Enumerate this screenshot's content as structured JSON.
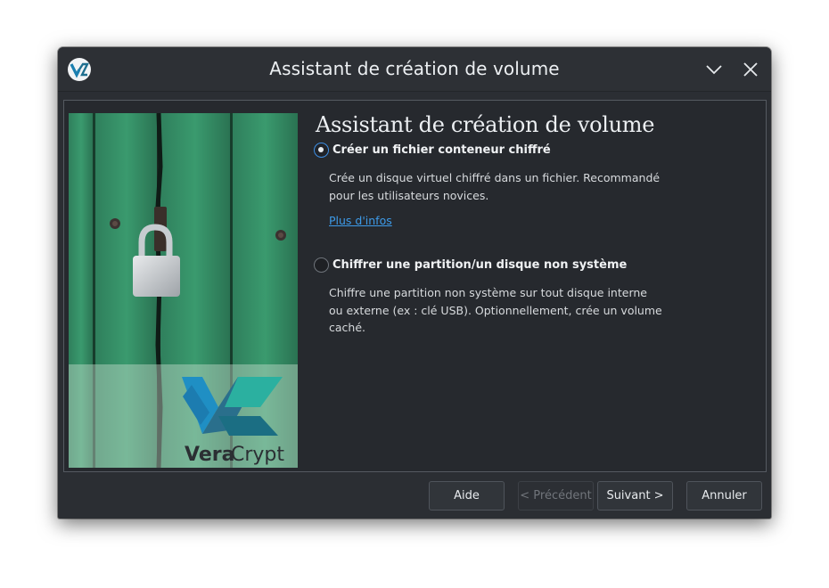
{
  "window": {
    "title": "Assistant de création de volume"
  },
  "wizard": {
    "heading": "Assistant de création de volume",
    "options": [
      {
        "label": "Créer un fichier conteneur chiffré",
        "selected": true,
        "description_line1": "Crée un disque virtuel chiffré dans un fichier. Recommandé",
        "description_line2": "pour les utilisateurs novices.",
        "link": "Plus d'infos"
      },
      {
        "label": "Chiffrer une partition/un disque non système",
        "selected": false,
        "description_line1": "Chiffre une partition non système sur tout disque interne",
        "description_line2": "ou externe (ex : clé USB). Optionnellement, crée un volume",
        "description_line3": "caché."
      }
    ]
  },
  "brand": {
    "name_part1": "Vera",
    "name_part2": "Crypt"
  },
  "buttons": {
    "help": "Aide",
    "previous": "< Précédent",
    "next": "Suivant >",
    "cancel": "Annuler"
  },
  "colors": {
    "accent": "#3d8ee4",
    "link": "#3d9be9",
    "window_bg": "#2b2e33"
  }
}
